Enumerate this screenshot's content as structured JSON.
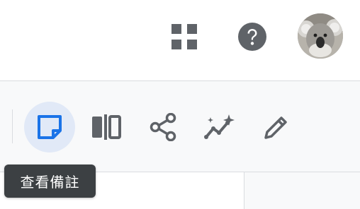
{
  "header": {
    "apps_icon": "apps-grid-icon",
    "help_icon": "help-circle-icon",
    "avatar_icon": "koala-avatar"
  },
  "toolbar": {
    "items": [
      {
        "name": "sticky-note-icon",
        "active": true
      },
      {
        "name": "compare-columns-icon",
        "active": false
      },
      {
        "name": "share-icon",
        "active": false
      },
      {
        "name": "sparkle-insights-icon",
        "active": false
      },
      {
        "name": "pencil-edit-icon",
        "active": false
      }
    ]
  },
  "tooltip": {
    "text": "查看備註"
  },
  "colors": {
    "accent": "#1a73e8",
    "active_bg": "#e1e9f7",
    "icon": "#5f6368",
    "tooltip_bg": "#3c4043"
  }
}
